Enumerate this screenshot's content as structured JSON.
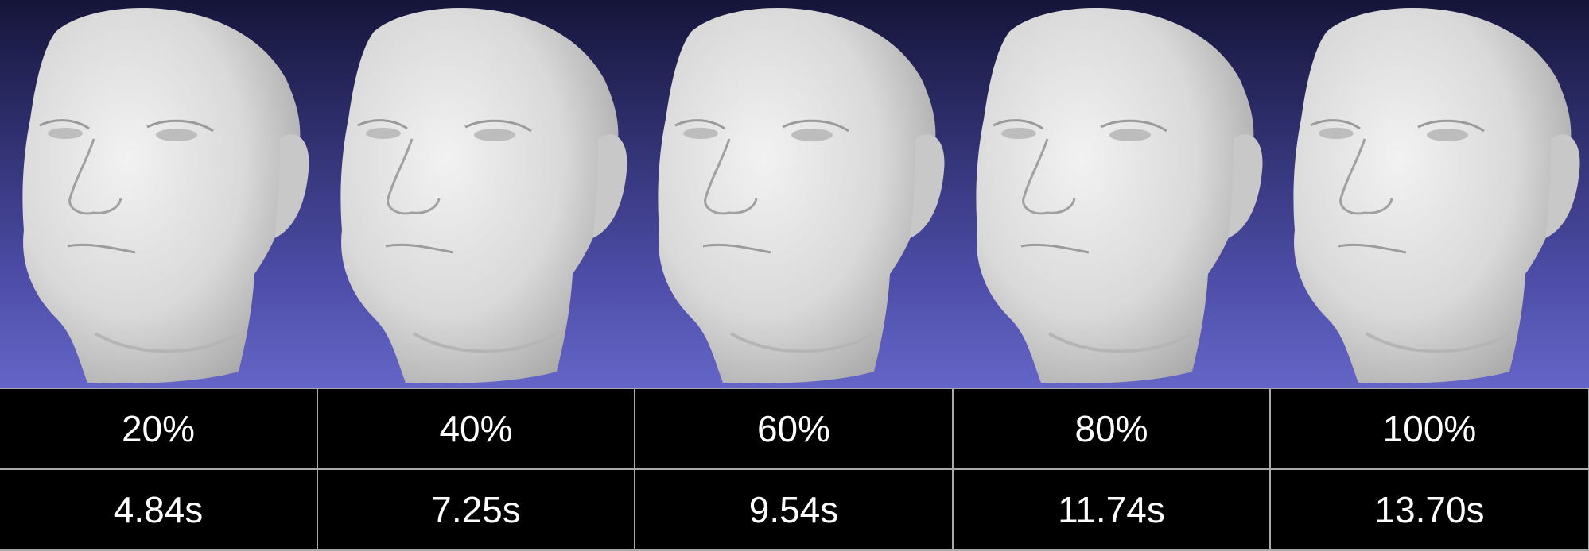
{
  "columns": [
    {
      "percent": "20%",
      "time": "4.84s"
    },
    {
      "percent": "40%",
      "time": "7.25s"
    },
    {
      "percent": "60%",
      "time": "9.54s"
    },
    {
      "percent": "80%",
      "time": "11.74s"
    },
    {
      "percent": "100%",
      "time": "13.70s"
    }
  ],
  "colors": {
    "background_top": "#15153a",
    "background_bottom": "#6565c8",
    "mesh": "#d9d9d9",
    "table_bg": "#000000",
    "table_text": "#ffffff",
    "table_lines": "#a9a9a9"
  }
}
